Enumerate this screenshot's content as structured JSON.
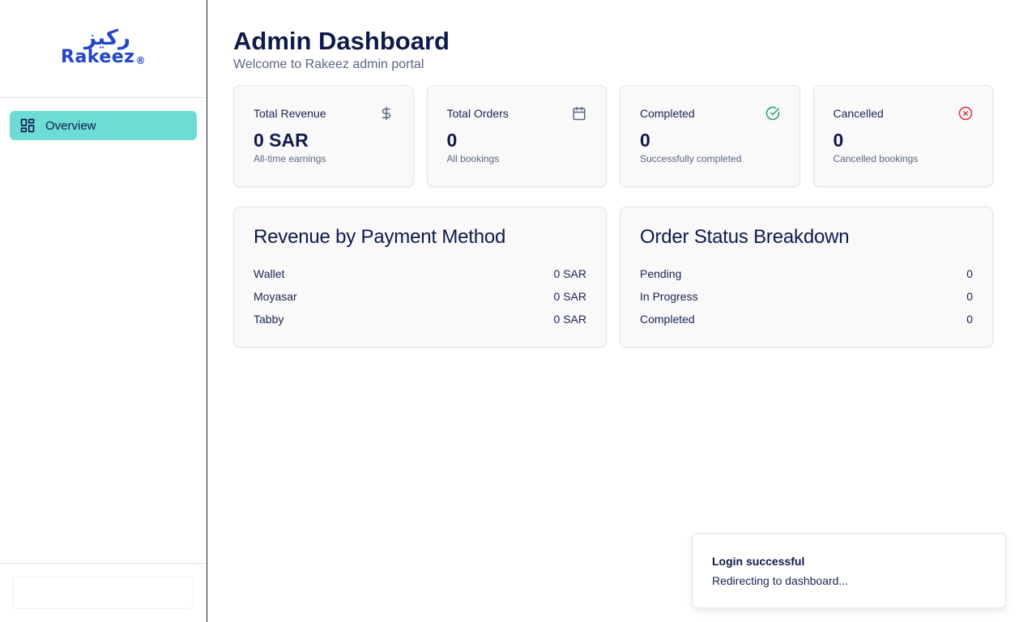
{
  "brand": {
    "arabic": "ركيز",
    "english": "Rakeez",
    "mark": "®",
    "color": "#2346c9"
  },
  "sidebar": {
    "items": [
      {
        "label": "Overview",
        "icon": "dashboard-grid-icon",
        "active": true
      }
    ]
  },
  "header": {
    "title": "Admin Dashboard",
    "subtitle": "Welcome to Rakeez admin portal"
  },
  "stats": [
    {
      "label": "Total Revenue",
      "value": "0 SAR",
      "sub": "All-time earnings",
      "icon": "dollar-icon"
    },
    {
      "label": "Total Orders",
      "value": "0",
      "sub": "All bookings",
      "icon": "calendar-icon"
    },
    {
      "label": "Completed",
      "value": "0",
      "sub": "Successfully completed",
      "icon": "check-circle-icon"
    },
    {
      "label": "Cancelled",
      "value": "0",
      "sub": "Cancelled bookings",
      "icon": "x-circle-icon"
    }
  ],
  "revenue_panel": {
    "title": "Revenue by Payment Method",
    "rows": [
      {
        "label": "Wallet",
        "value": "0 SAR"
      },
      {
        "label": "Moyasar",
        "value": "0 SAR"
      },
      {
        "label": "Tabby",
        "value": "0 SAR"
      }
    ]
  },
  "status_panel": {
    "title": "Order Status Breakdown",
    "rows": [
      {
        "label": "Pending",
        "value": "0"
      },
      {
        "label": "In Progress",
        "value": "0"
      },
      {
        "label": "Completed",
        "value": "0"
      }
    ]
  },
  "toast": {
    "title": "Login successful",
    "description": "Redirecting to dashboard..."
  },
  "colors": {
    "accent": "#6cdcd5",
    "success": "#22a559",
    "danger": "#d6333f",
    "text": "#0f1a4a"
  }
}
